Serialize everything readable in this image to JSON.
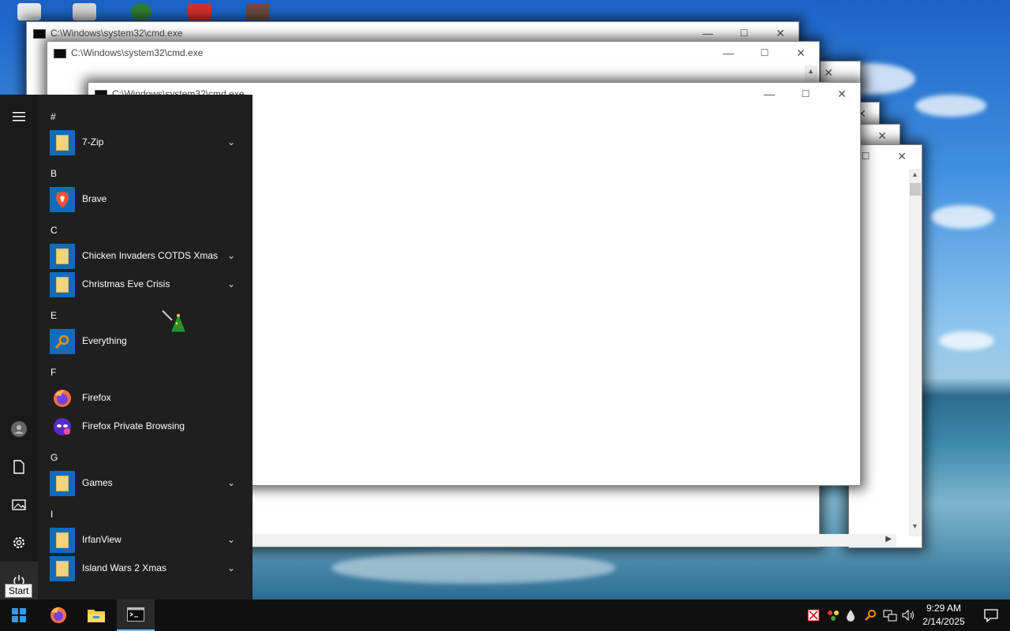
{
  "desktop": {
    "windows": [
      {
        "title": "C:\\Windows\\system32\\cmd.exe"
      },
      {
        "title": "C:\\Windows\\system32\\cmd.exe"
      },
      {
        "title": "C:\\Windows\\system32\\cmd.exe"
      }
    ]
  },
  "start_menu": {
    "sections": [
      {
        "letter": "#"
      },
      {
        "letter": "B"
      },
      {
        "letter": "C"
      },
      {
        "letter": "E"
      },
      {
        "letter": "F"
      },
      {
        "letter": "G"
      },
      {
        "letter": "I"
      }
    ],
    "apps": [
      {
        "label": "7-Zip",
        "icon": "folder-icon",
        "expandable": true
      },
      {
        "label": "Brave",
        "icon": "brave-icon",
        "expandable": false
      },
      {
        "label": "Chicken Invaders COTDS Xmas",
        "icon": "folder-icon",
        "expandable": true
      },
      {
        "label": "Christmas Eve Crisis",
        "icon": "folder-icon",
        "expandable": true
      },
      {
        "label": "Everything",
        "icon": "everything-search-icon",
        "expandable": false
      },
      {
        "label": "Firefox",
        "icon": "firefox-icon",
        "expandable": false
      },
      {
        "label": "Firefox Private Browsing",
        "icon": "firefox-private-icon",
        "expandable": false
      },
      {
        "label": "Games",
        "icon": "folder-icon",
        "expandable": true
      },
      {
        "label": "IrfanView",
        "icon": "folder-icon",
        "expandable": true
      },
      {
        "label": "Island Wars 2 Xmas",
        "icon": "folder-icon",
        "expandable": true
      }
    ],
    "rail": [
      "hamburger-menu-icon",
      "user-account-icon",
      "documents-icon",
      "pictures-icon",
      "settings-gear-icon",
      "power-icon"
    ]
  },
  "tooltip": {
    "text": "Start"
  },
  "taskbar": {
    "pinned": [
      "start-windows-icon",
      "firefox-icon",
      "file-explorer-icon",
      "command-prompt-icon"
    ],
    "tray": [
      "security-icon",
      "network-share-icon",
      "water-drop-icon",
      "everything-search-icon",
      "network-icon",
      "volume-icon"
    ],
    "clock": {
      "time": "9:29 AM",
      "date": "2/14/2025"
    },
    "notification_icon": "action-center-icon"
  },
  "colors": {
    "accent": "#0f6cbd",
    "menu_bg": "#1f1f1f",
    "taskbar_bg": "#101010"
  }
}
